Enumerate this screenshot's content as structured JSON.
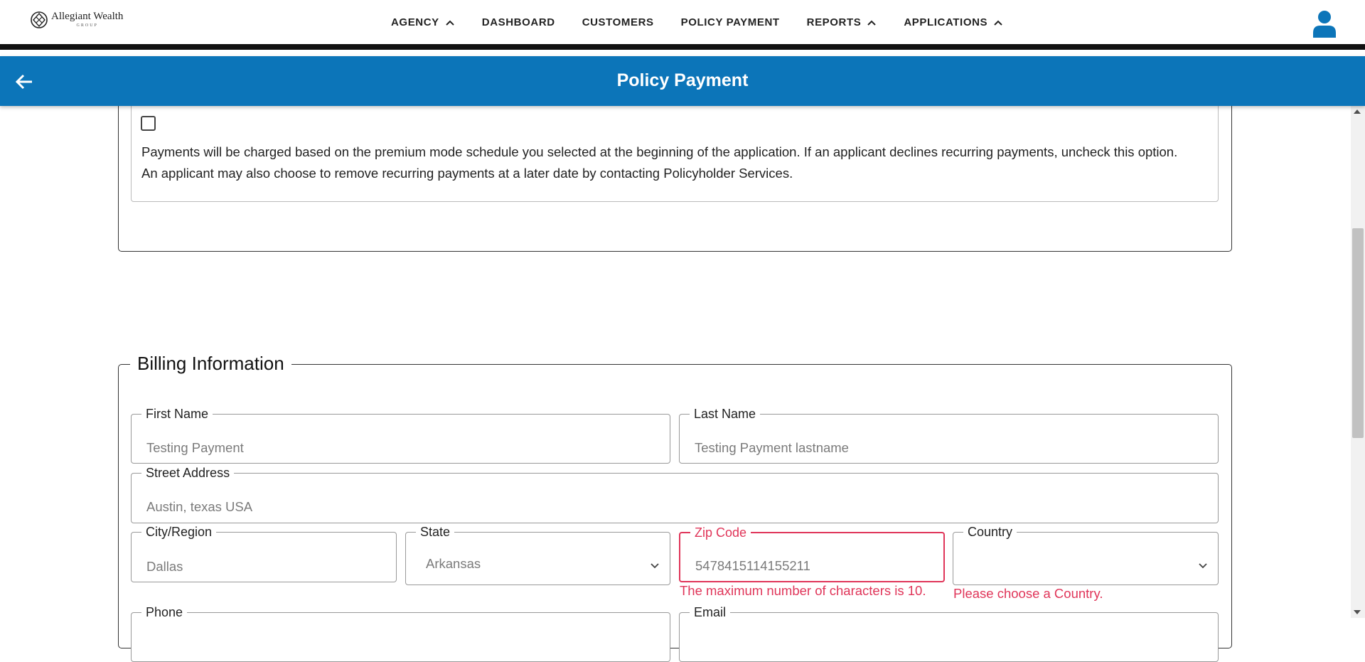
{
  "brand": {
    "name": "Allegiant Wealth",
    "subtitle": "GROUP"
  },
  "nav": {
    "items": [
      {
        "label": "AGENCY",
        "has_chevron": true
      },
      {
        "label": "DASHBOARD",
        "has_chevron": false
      },
      {
        "label": "CUSTOMERS",
        "has_chevron": false
      },
      {
        "label": "POLICY PAYMENT",
        "has_chevron": false
      },
      {
        "label": "REPORTS",
        "has_chevron": true
      },
      {
        "label": "APPLICATIONS",
        "has_chevron": true
      }
    ],
    "user_icon": "user-icon"
  },
  "header": {
    "title": "Policy Payment",
    "back_icon": "arrow-left-icon"
  },
  "recurring": {
    "checked": false,
    "note": "Payments will be charged based on the premium mode schedule you selected at the beginning of the application. If an applicant declines recurring payments, uncheck this option. An applicant may also choose to remove recurring payments at a later date by contacting Policyholder Services."
  },
  "billing": {
    "title": "Billing Information",
    "first_name": {
      "label": "First Name",
      "value": "Testing Payment"
    },
    "last_name": {
      "label": "Last Name",
      "value": "Testing Payment lastname"
    },
    "street": {
      "label": "Street Address",
      "value": "Austin, texas USA"
    },
    "city": {
      "label": "City/Region",
      "value": "Dallas"
    },
    "state": {
      "label": "State",
      "value": "Arkansas"
    },
    "zip": {
      "label": "Zip Code",
      "value": "5478415114155211",
      "error": "The maximum number of characters is 10."
    },
    "country": {
      "label": "Country",
      "value": "",
      "error": "Please choose a Country."
    },
    "phone": {
      "label": "Phone"
    },
    "email": {
      "label": "Email"
    }
  },
  "colors": {
    "primary": "#0c75b9",
    "error": "#e03559",
    "nav_border": "#111111"
  }
}
